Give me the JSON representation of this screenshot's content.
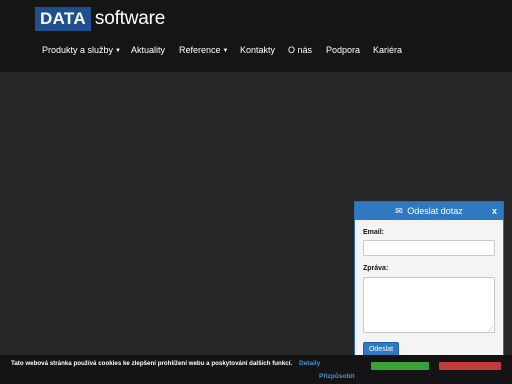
{
  "header": {
    "logo_box": "DATA",
    "logo_word": "software"
  },
  "nav": {
    "items": [
      {
        "label": "Produkty a služby",
        "dropdown": true
      },
      {
        "label": "Aktuality",
        "dropdown": false
      },
      {
        "label": "Reference",
        "dropdown": true
      },
      {
        "label": "Kontakty",
        "dropdown": false
      },
      {
        "label": "O nás",
        "dropdown": false
      },
      {
        "label": "Podpora",
        "dropdown": false
      },
      {
        "label": "Kariéra",
        "dropdown": false
      }
    ],
    "caret": "▼"
  },
  "widget": {
    "title": "Odeslat dotaz",
    "mail_icon": "✉",
    "close": "x",
    "email_label": "Email:",
    "email_value": "",
    "message_label": "Zpráva:",
    "message_value": "",
    "submit_label": "Odeslat",
    "resize_icon": "⟋"
  },
  "cookie": {
    "text": "Tato webová stránka používá cookies ke zlepšení prohlížení webu a poskytování dalších funkcí.",
    "details_link": "Detaily",
    "customize_link": "Přizpůsobit"
  },
  "colors": {
    "header_bg": "#151515",
    "body_bg": "#262626",
    "logo_blue": "#1f4f8f",
    "widget_blue": "#2f78c2",
    "link_blue": "#4a90d9",
    "accept_green": "#3aa23a",
    "decline_red": "#c43b3b"
  }
}
